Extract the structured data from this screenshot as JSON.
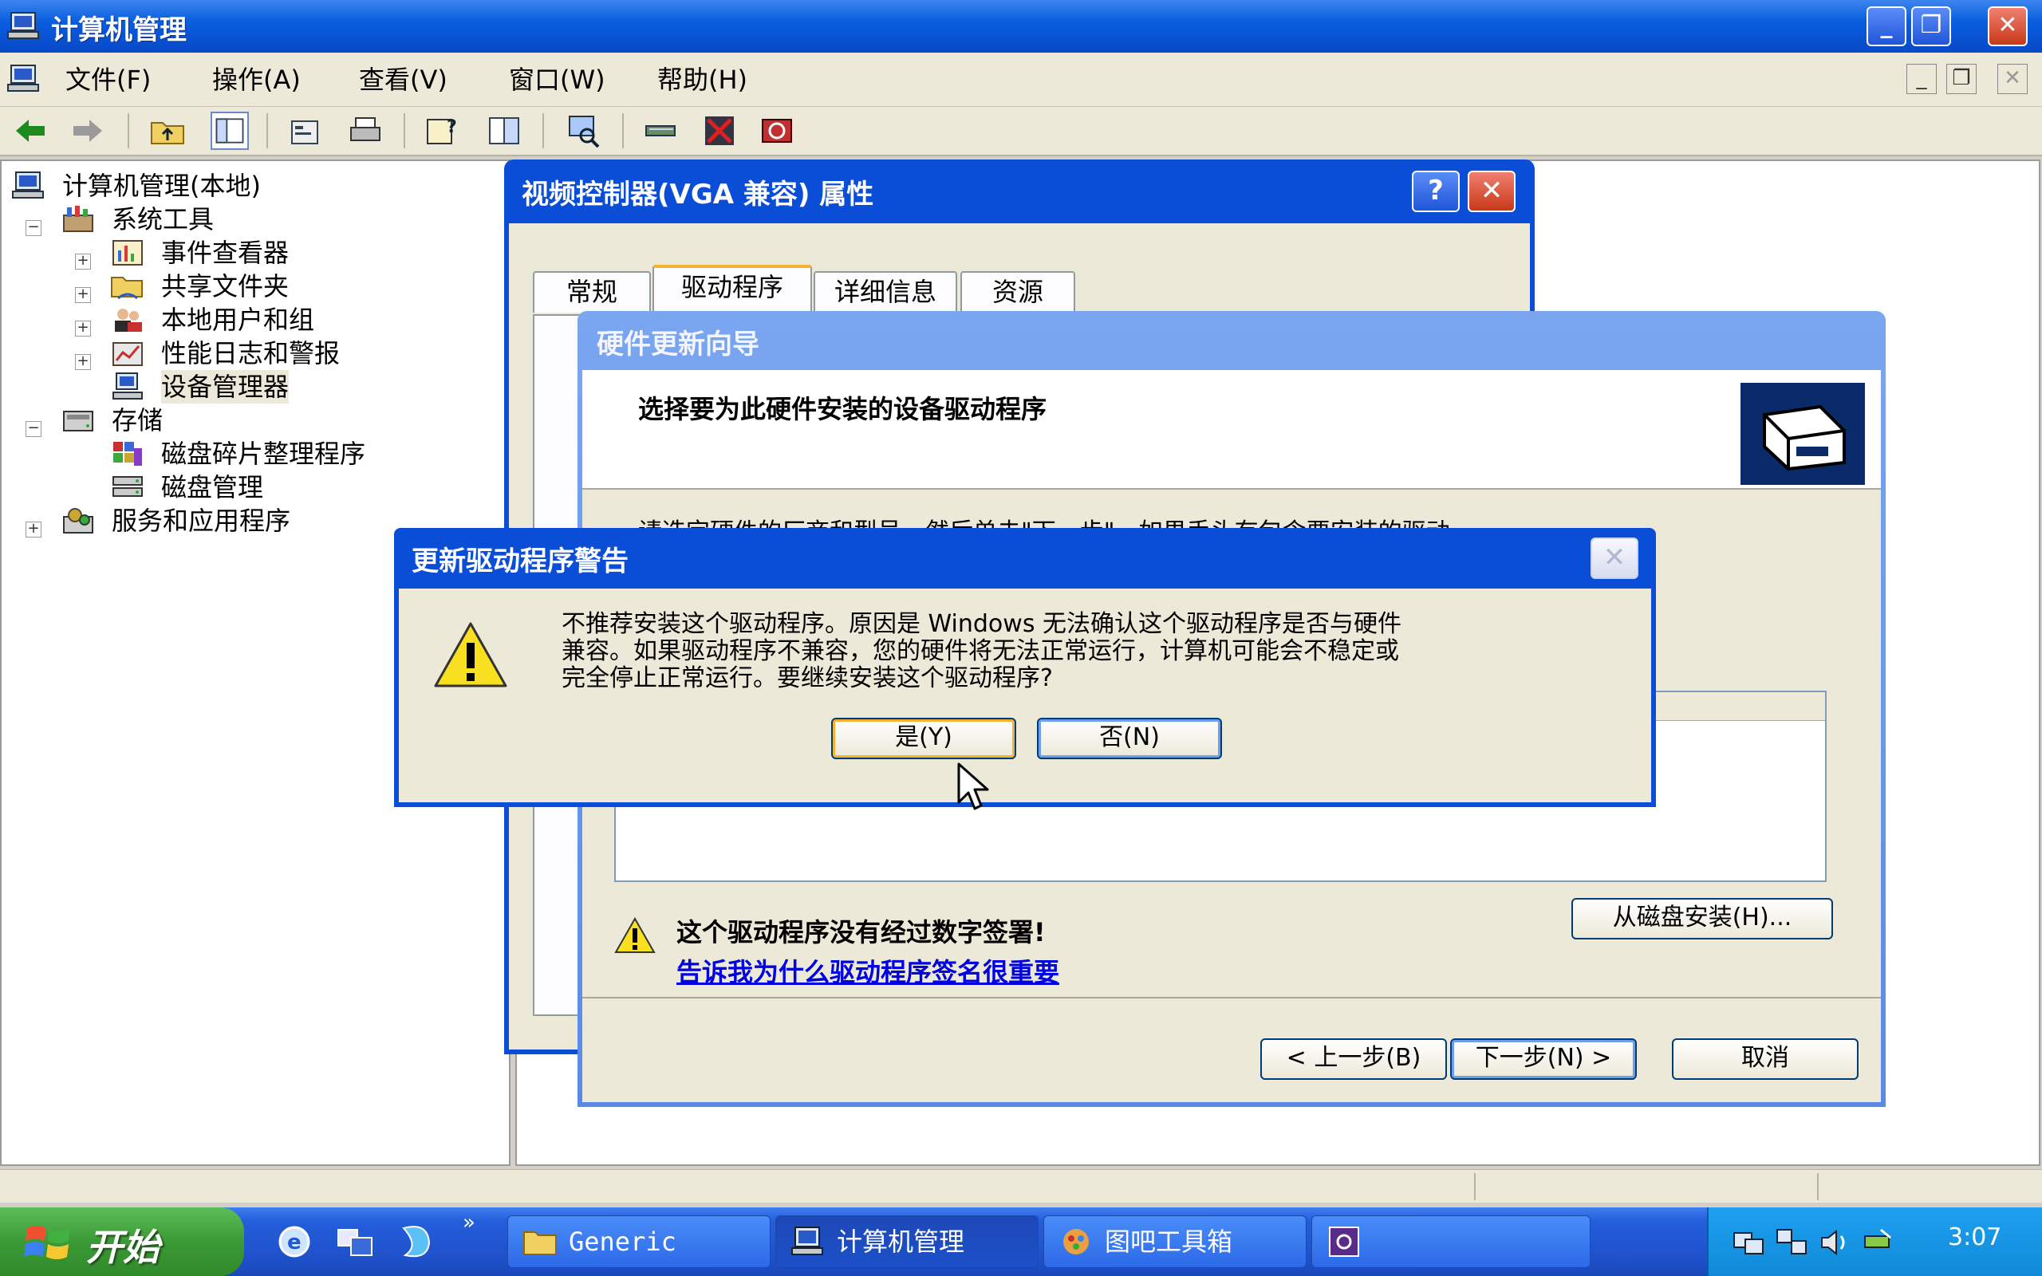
{
  "window": {
    "title": "计算机管理",
    "buttons": {
      "minimize": "_",
      "restore": "❐",
      "close": "✕"
    }
  },
  "menubar": {
    "items": [
      "文件(F)",
      "操作(A)",
      "查看(V)",
      "窗口(W)",
      "帮助(H)"
    ]
  },
  "tree": {
    "root": "计算机管理(本地)",
    "system_tools": "系统工具",
    "event_viewer": "事件查看器",
    "shared_folders": "共享文件夹",
    "local_users": "本地用户和组",
    "perf_logs": "性能日志和警报",
    "device_manager": "设备管理器",
    "storage": "存储",
    "defrag": "磁盘碎片整理程序",
    "disk_mgmt": "磁盘管理",
    "services": "服务和应用程序"
  },
  "props_dialog": {
    "title": "视频控制器(VGA 兼容) 属性",
    "help_btn": "?",
    "tabs": [
      "常规",
      "驱动程序",
      "详细信息",
      "资源"
    ],
    "active_tab": "驱动程序"
  },
  "wizard": {
    "title": "硬件更新向导",
    "heading": "选择要为此硬件安装的设备驱动程序",
    "instruction_partial": "请选定硬件的厂商和型号，然后单击\"下一步\"。如果手头有包含要安装的驱动",
    "unsigned_warning": "这个驱动程序没有经过数字签署!",
    "signing_link": "告诉我为什么驱动程序签名很重要",
    "have_disk": "从磁盘安装(H)...",
    "back": "< 上一步(B)",
    "next": "下一步(N) >",
    "cancel": "取消"
  },
  "alert": {
    "title": "更新驱动程序警告",
    "close": "✕",
    "message_line1": "不推荐安装这个驱动程序。原因是 Windows 无法确认这个驱动程序是否与硬件",
    "message_line2": "兼容。如果驱动程序不兼容，您的硬件将无法正常运行，计算机可能会不稳定或",
    "message_line3": "完全停止正常运行。要继续安装这个驱动程序?",
    "yes": "是(Y)",
    "no": "否(N)"
  },
  "taskbar": {
    "start": "开始",
    "tasks": [
      "Generic",
      "计算机管理",
      "图吧工具箱",
      ""
    ],
    "active_task": "计算机管理",
    "clock": "3:07"
  }
}
